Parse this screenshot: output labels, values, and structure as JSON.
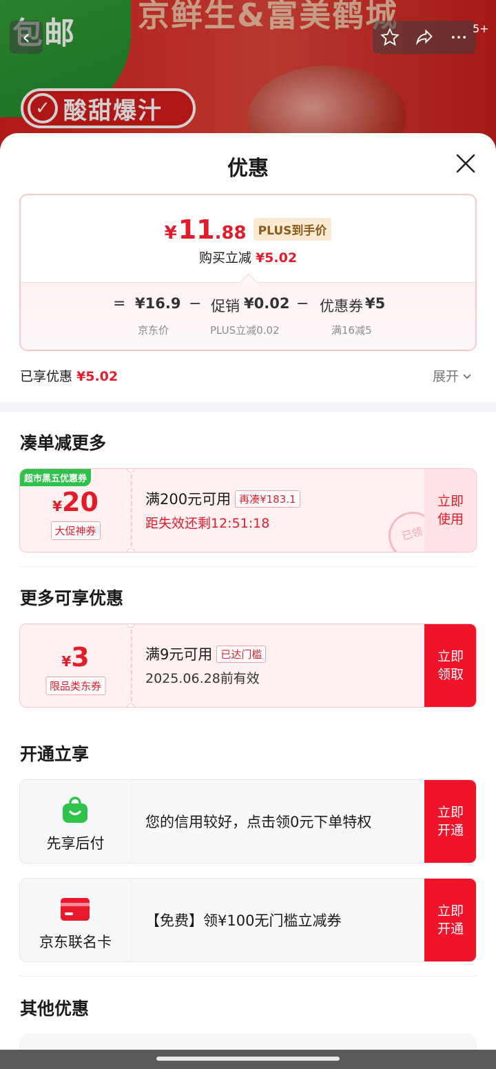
{
  "background": {
    "banner_left_text": "包邮",
    "banner_top_text": "京鲜生&富美鹤城",
    "pill_text": "酸甜爆汁",
    "badge": "5+"
  },
  "sheet": {
    "title": "优惠"
  },
  "summary": {
    "currency": "¥",
    "final_price_int": "11",
    "final_price_dec": ".88",
    "plus_tag": "PLUS到手价",
    "reduce_label": "购买立减",
    "reduce_amount": "¥5.02",
    "formula": {
      "equals": "=",
      "jd_price": "¥16.9",
      "minus1": "−",
      "promo_label": "促销",
      "promo_value": "¥0.02",
      "minus2": "−",
      "coupon_label": "优惠券",
      "coupon_value": "¥5"
    },
    "captions": {
      "jd_price": "京东价",
      "promo": "PLUS立减0.02",
      "coupon": "满16减5"
    }
  },
  "enjoyed": {
    "label": "已享优惠",
    "amount": "¥5.02",
    "expand_label": "展开"
  },
  "sections": {
    "combine": "凑单减更多",
    "more": "更多可享优惠",
    "activate": "开通立享",
    "other": "其他优惠"
  },
  "coupon_combine": {
    "tag": "超市黑五优惠券",
    "currency": "¥",
    "amount": "20",
    "label": "大促神券",
    "condition": "满200元可用",
    "extra_tag": "再凑¥183.1",
    "countdown": "距失效还剩12:51:18",
    "stamp": "已领",
    "action": "立即使用"
  },
  "coupon_more": {
    "currency": "¥",
    "amount": "3",
    "label": "限品类东券",
    "condition": "满9元可用",
    "extra_tag": "已达门槛",
    "validity": "2025.06.28前有效",
    "action": "立即领取"
  },
  "services": [
    {
      "name": "先享后付",
      "icon": "shopping-bag-icon",
      "icon_color": "#2fc24a",
      "desc": "您的信用较好，点击领0元下单特权",
      "action": "立即开通"
    },
    {
      "name": "京东联名卡",
      "icon": "credit-card-icon",
      "icon_color": "#e8192c",
      "desc": "【免费】领¥100无门槛立减券",
      "action": "立即开通"
    }
  ],
  "colors": {
    "accent_red": "#e21c2a",
    "action_red": "#f0142a",
    "green": "#2fc24a"
  }
}
